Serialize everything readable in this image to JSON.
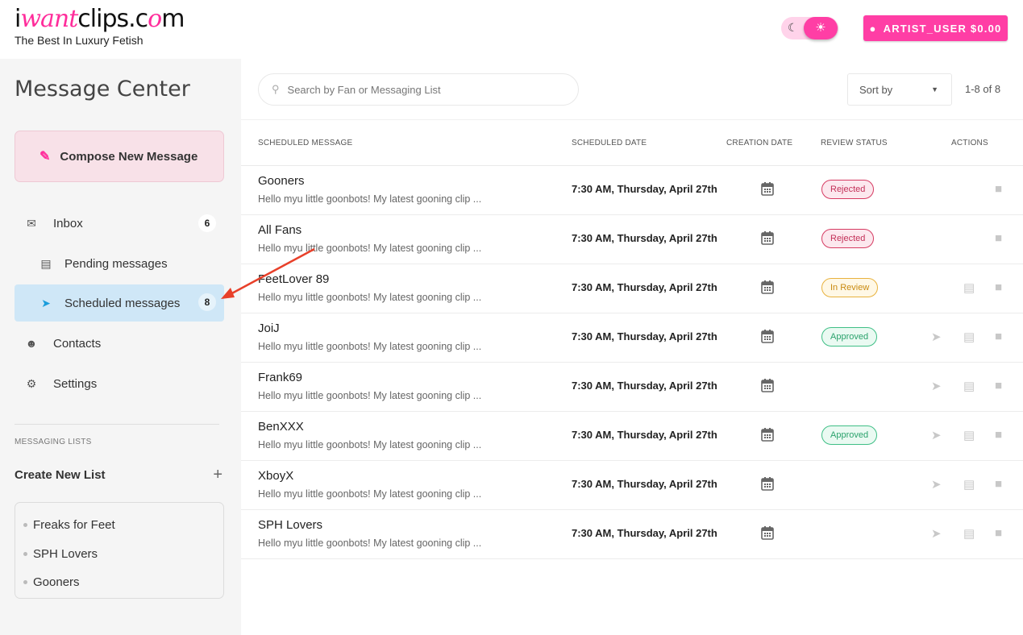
{
  "header": {
    "logo_prefix": "i",
    "logo_accent": "want",
    "logo_suffix": "clips.c",
    "logo_accent2": "o",
    "logo_end": "m",
    "tagline": "The Best In Luxury Fetish",
    "account_label": "ARTIST_USER $0.00"
  },
  "sidebar": {
    "title": "Message Center",
    "compose_label": "Compose New Message",
    "nav": [
      {
        "label": "Inbox",
        "badge": "6"
      },
      {
        "label": "Pending messages"
      },
      {
        "label": "Scheduled messages",
        "badge": "8"
      },
      {
        "label": "Contacts"
      },
      {
        "label": "Settings"
      }
    ],
    "lists_heading": "MESSAGING LISTS",
    "create_list_label": "Create New List",
    "lists": [
      "Freaks for Feet",
      "SPH Lovers",
      "Gooners"
    ]
  },
  "main": {
    "search_placeholder": "Search by Fan or Messaging List",
    "sort_label": "Sort by",
    "page_count": "1-8 of 8",
    "columns": [
      "SCHEDULED MESSAGE",
      "SCHEDULED DATE",
      "CREATION DATE",
      "REVIEW STATUS",
      "ACTIONS"
    ],
    "rows": [
      {
        "name": "Gooners",
        "preview": "Hello myu little goonbots! My latest gooning clip ...",
        "date": "7:30 AM, Thursday, April 27th",
        "status": "Rejected"
      },
      {
        "name": "All Fans",
        "preview": "Hello myu little goonbots! My latest gooning clip ...",
        "date": "7:30 AM, Thursday, April 27th",
        "status": "Rejected"
      },
      {
        "name": "FeetLover 89",
        "preview": "Hello myu little goonbots! My latest gooning clip ...",
        "date": "7:30 AM, Thursday, April 27th",
        "status": "In Review"
      },
      {
        "name": "JoiJ",
        "preview": "Hello myu little goonbots! My latest gooning clip ...",
        "date": "7:30 AM, Thursday, April 27th",
        "status": "Approved"
      },
      {
        "name": "Frank69",
        "preview": "Hello myu little goonbots! My latest gooning clip ...",
        "date": "7:30 AM, Thursday, April 27th",
        "status": ""
      },
      {
        "name": "BenXXX",
        "preview": "Hello myu little goonbots! My latest gooning clip ...",
        "date": "7:30 AM, Thursday, April 27th",
        "status": "Approved"
      },
      {
        "name": "XboyX",
        "preview": "Hello myu little goonbots! My latest gooning clip ...",
        "date": "7:30 AM, Thursday, April 27th",
        "status": ""
      },
      {
        "name": "SPH Lovers",
        "preview": "Hello myu little goonbots! My latest gooning clip ...",
        "date": "7:30 AM, Thursday, April 27th",
        "status": ""
      }
    ]
  },
  "colors": {
    "brand": "#ff3ea5",
    "active_nav": "#cfe7f7",
    "annotation_arrow": "#e8402a"
  }
}
